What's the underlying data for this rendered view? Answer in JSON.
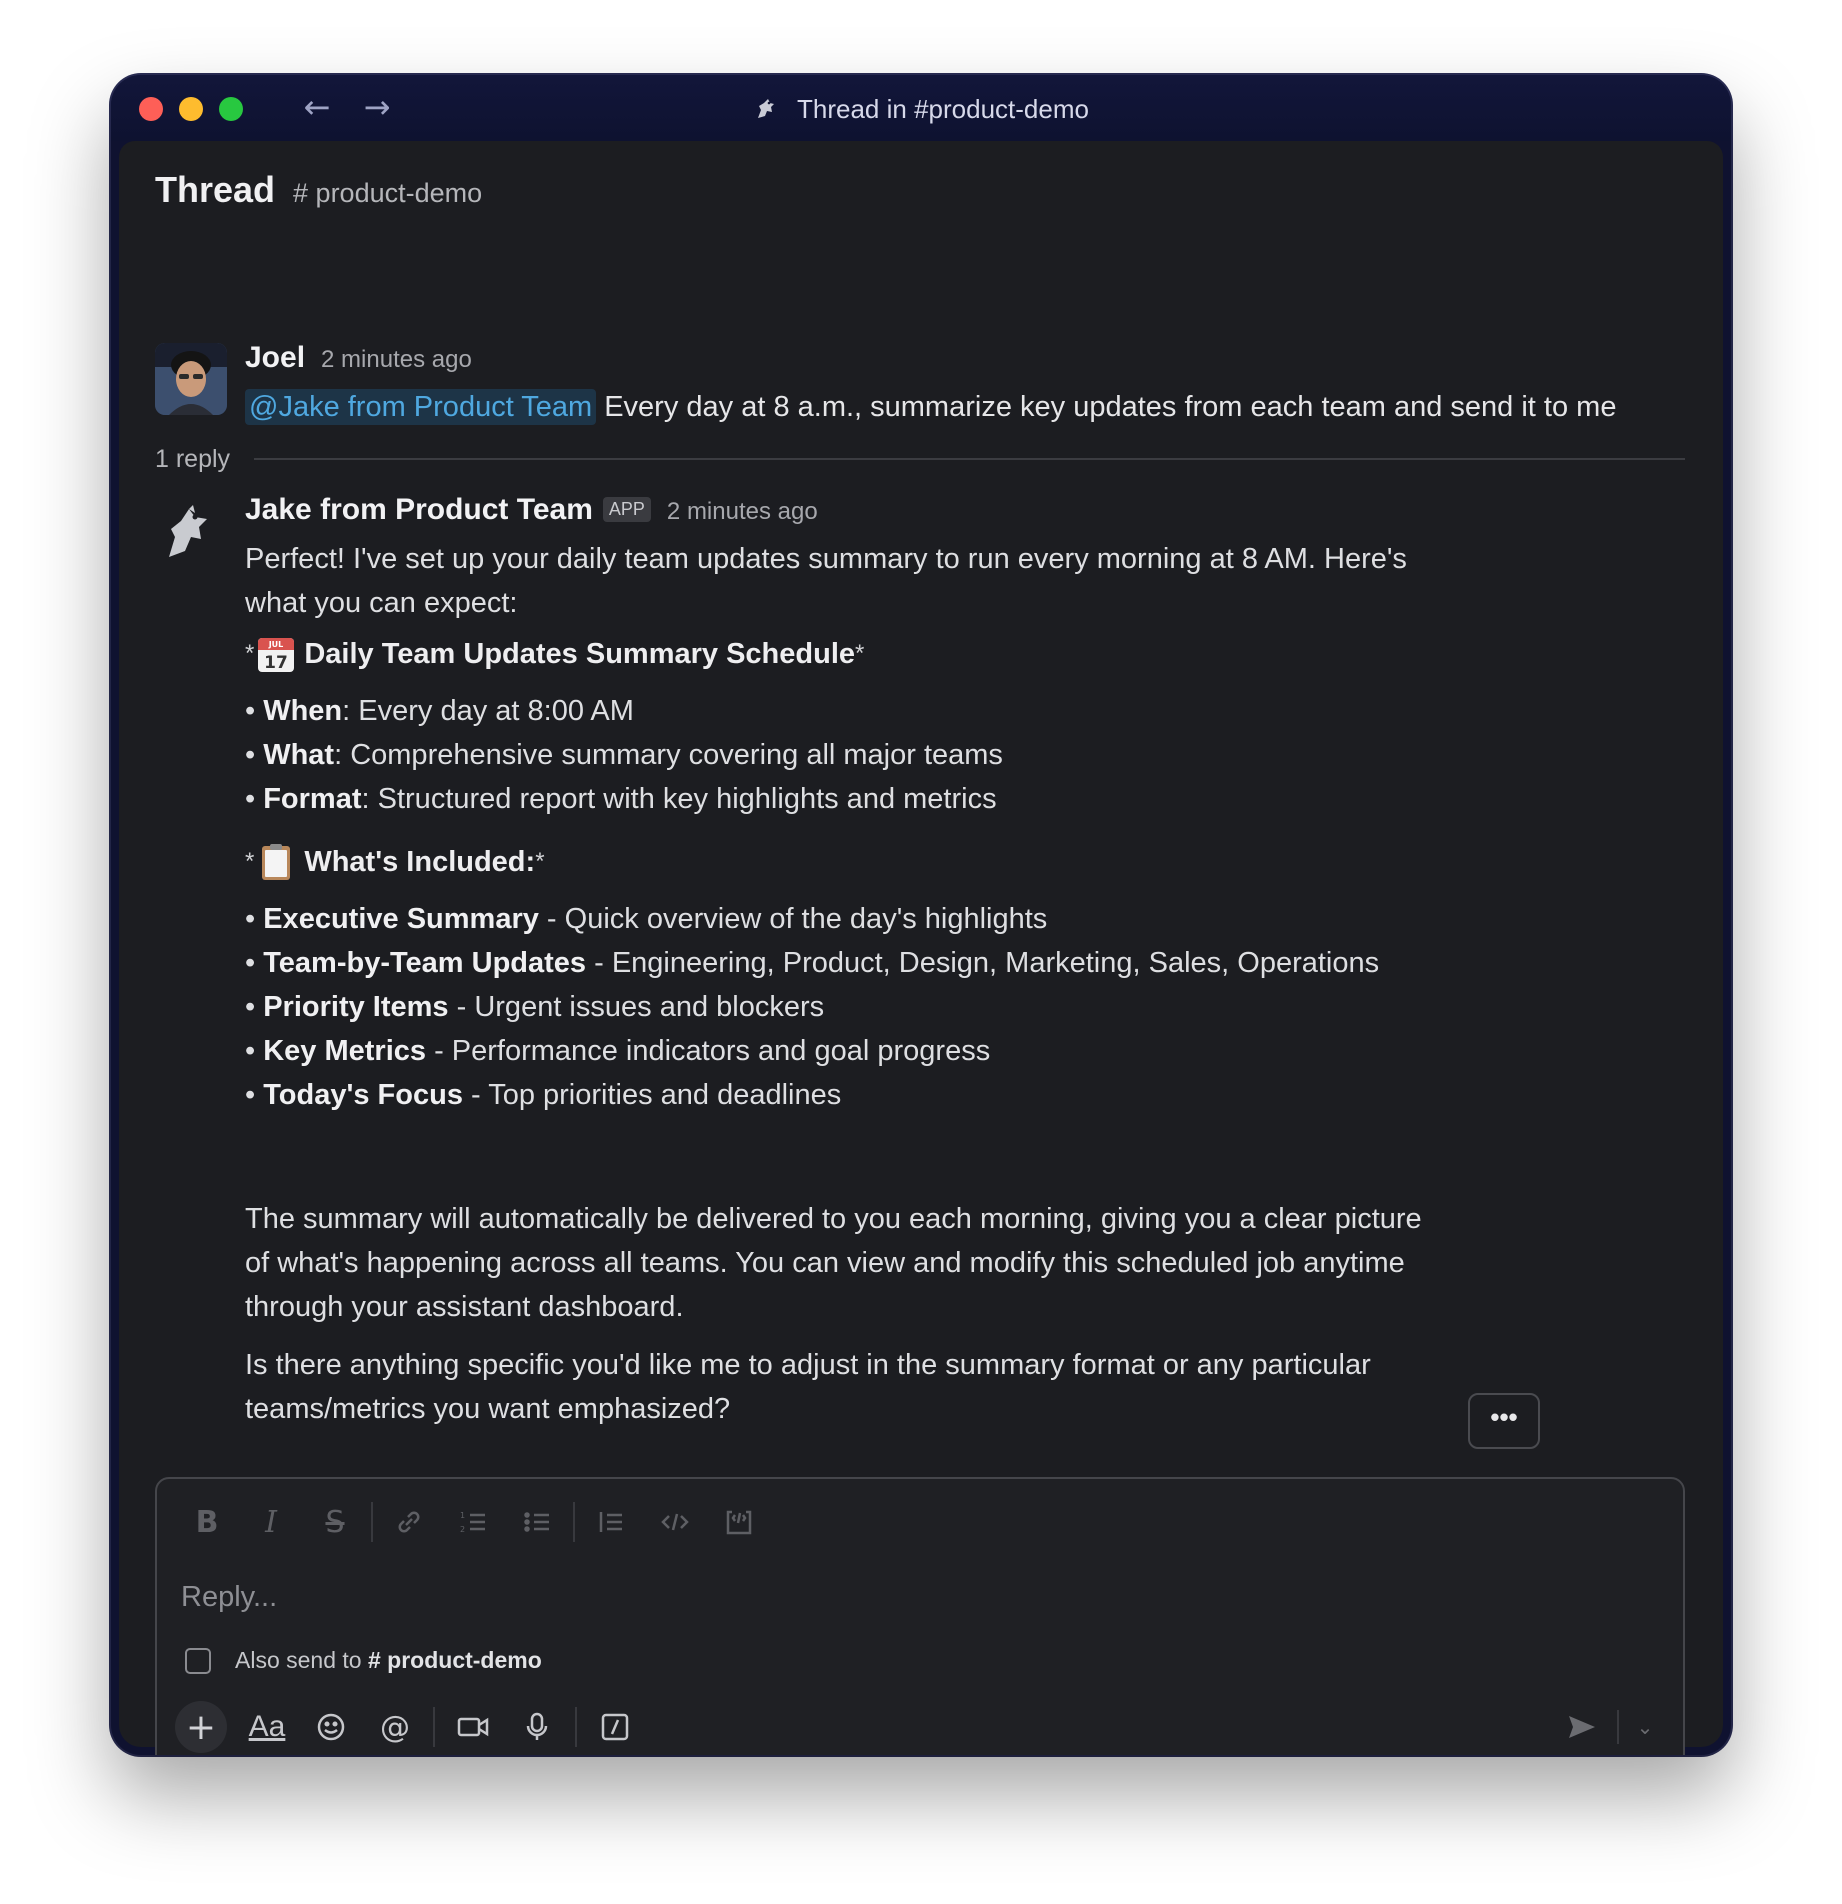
{
  "window": {
    "title": "Thread in #product-demo",
    "back_arrow": "←",
    "forward_arrow": "→"
  },
  "thread": {
    "title": "Thread",
    "channel": "# product-demo"
  },
  "parent_message": {
    "sender": "Joel",
    "timestamp": "2 minutes ago",
    "mention": "@Jake from Product Team",
    "text": "Every day at 8 a.m., summarize key updates from each team and send it to me"
  },
  "reply_count": "1 reply",
  "reply_message": {
    "sender": "Jake from Product Team",
    "badge": "APP",
    "timestamp": "2 minutes ago",
    "intro": "Perfect! I've set up your daily team updates summary to run every morning at 8 AM. Here's what you can expect:",
    "schedule_heading": "Daily Team Updates Summary Schedule",
    "schedule_items": [
      {
        "label": "When",
        "text": ": Every day at 8:00 AM"
      },
      {
        "label": "What",
        "text": ": Comprehensive summary covering all major teams"
      },
      {
        "label": "Format",
        "text": ": Structured report with key highlights and metrics"
      }
    ],
    "included_heading": "What's Included:",
    "included_items": [
      {
        "label": "Executive Summary",
        "text": " - Quick overview of the day's highlights"
      },
      {
        "label": "Team-by-Team Updates",
        "text": " - Engineering, Product, Design, Marketing, Sales, Operations"
      },
      {
        "label": "Priority Items",
        "text": " - Urgent issues and blockers"
      },
      {
        "label": "Key Metrics",
        "text": " - Performance indicators and goal progress"
      },
      {
        "label": "Today's Focus",
        "text": " - Top priorities and deadlines"
      }
    ],
    "closing_1": "The summary will automatically be delivered to you each morning, giving you a clear picture of what's happening across all teams. You can view and modify this scheduled job anytime through your assistant dashboard.",
    "closing_2": "Is there anything specific you'd like me to adjust in the summary format or any particular teams/metrics you want emphasized?",
    "calendar_emoji_month": "JUL",
    "calendar_emoji_day": "17"
  },
  "more_actions": "•••",
  "composer": {
    "placeholder": "Reply...",
    "value": "",
    "also_send_prefix": "Also send to",
    "also_send_channel": "# product-demo",
    "format_buttons": [
      "bold-icon",
      "italic-icon",
      "strikethrough-icon",
      "link-icon",
      "ordered-list-icon",
      "bullet-list-icon",
      "blockquote-icon",
      "code-icon",
      "code-block-icon"
    ],
    "bottom_buttons": [
      "plus-icon",
      "text-format-icon",
      "emoji-icon",
      "mention-icon",
      "video-icon",
      "microphone-icon",
      "slash-command-icon"
    ],
    "text_format_label": "Aa",
    "mention_label": "@",
    "plus_label": "+"
  },
  "colors": {
    "window_frame": "#0f1230",
    "panel_bg": "#1c1d21",
    "mention_fg": "#4fa8e0",
    "mention_bg": "#1d3447",
    "traffic_red": "#fe5f57",
    "traffic_yellow": "#febc2e",
    "traffic_green": "#28c840"
  }
}
